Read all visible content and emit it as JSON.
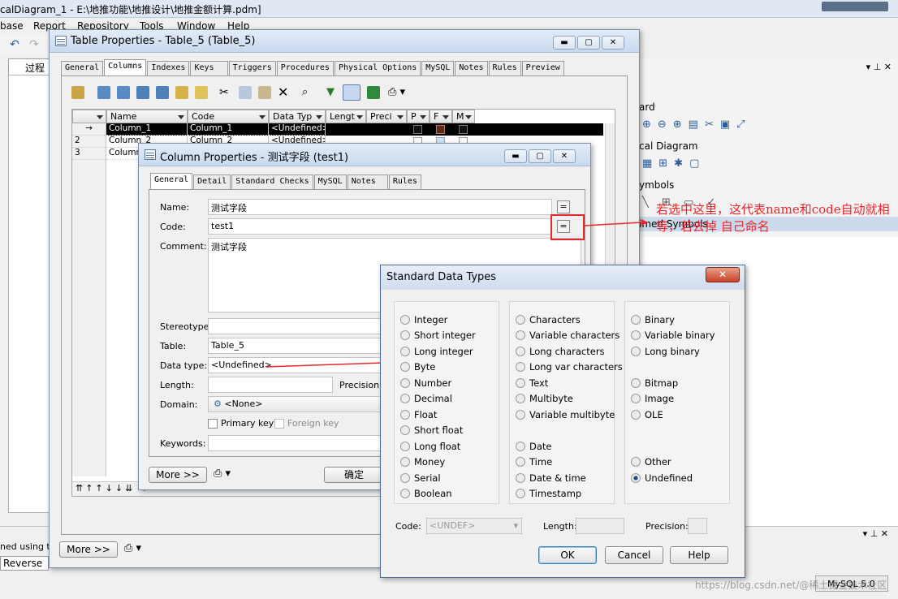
{
  "app": {
    "title": "calDiagram_1 - E:\\地推功能\\地推设计\\地推金额计算.pdm]",
    "menu": [
      "base",
      "Report",
      "Repository",
      "Tools",
      "Window",
      "Help"
    ],
    "left_tab": "过程",
    "right_sections": [
      "ard",
      "cal Diagram",
      "ymbols",
      "imed Symbols"
    ],
    "bottom_left": "ned using the",
    "bottom_reverse": "Reverse",
    "bottom_more": "More >>",
    "status_db": "MySQL 5.0",
    "watermark": "https://blog.csdn.net/@稀土掘金技术社区"
  },
  "table_props": {
    "title": "Table Properties - Table_5 (Table_5)",
    "tabs": [
      "General",
      "Columns",
      "Indexes",
      "Keys",
      "Triggers",
      "Procedures",
      "Physical Options",
      "MySQL",
      "Notes",
      "Rules",
      "Preview"
    ],
    "columns": [
      "Name",
      "Code",
      "Data Typ",
      "Lengt",
      "Preci",
      "P",
      "F",
      "M"
    ],
    "rows": [
      {
        "num": "→",
        "name": "Column_1",
        "code": "Column_1",
        "type": "<Undefined>"
      },
      {
        "num": "2",
        "name": "Column_2",
        "code": "Column_2",
        "type": "<Undefined>"
      },
      {
        "num": "3",
        "name": "Column",
        "code": "",
        "type": ""
      }
    ]
  },
  "col_props": {
    "title": "Column Properties - 测试字段 (test1)",
    "tabs": [
      "General",
      "Detail",
      "Standard Checks",
      "MySQL",
      "Notes",
      "Rules"
    ],
    "name_label": "Name:",
    "name_value": "测试字段",
    "code_label": "Code:",
    "code_value": "test1",
    "comment_label": "Comment:",
    "comment_value": "测试字段",
    "stereotype_label": "Stereotype:",
    "table_label": "Table:",
    "table_value": "Table_5",
    "datatype_label": "Data type:",
    "datatype_value": "<Undefined>",
    "length_label": "Length:",
    "precision_label": "Precision:",
    "domain_label": "Domain:",
    "domain_value": "<None>",
    "primary_key": "Primary key",
    "foreign_key": "Foreign key",
    "keywords_label": "Keywords:",
    "more_btn": "More >>",
    "ok_btn": "确定"
  },
  "std_types": {
    "title": "Standard Data Types",
    "col1": [
      "Integer",
      "Short integer",
      "Long integer",
      "Byte",
      "Number",
      "Decimal",
      "Float",
      "Short float",
      "Long float",
      "Money",
      "Serial",
      "Boolean"
    ],
    "col2a": [
      "Characters",
      "Variable characters",
      "Long characters",
      "Long var characters",
      "Text",
      "Multibyte",
      "Variable multibyte"
    ],
    "col2b": [
      "Date",
      "Time",
      "Date & time",
      "Timestamp"
    ],
    "col3a": [
      "Binary",
      "Variable binary",
      "Long binary"
    ],
    "col3b": [
      "Bitmap",
      "Image",
      "OLE"
    ],
    "col3c": [
      "Other",
      "Undefined"
    ],
    "selected": "Undefined",
    "code_label": "Code:",
    "code_value": "<UNDEF>",
    "length_label": "Length:",
    "precision_label": "Precision:",
    "ok": "OK",
    "cancel": "Cancel",
    "help": "Help"
  },
  "annotation": "若选中这里，这代表name和code自动就相等，若去掉 自己命名"
}
